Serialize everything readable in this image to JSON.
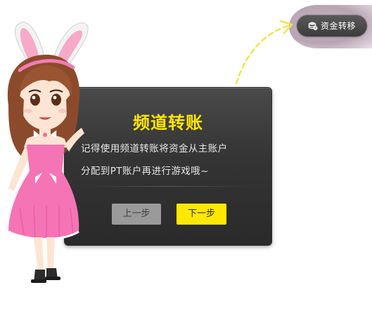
{
  "top_button": {
    "label": "资金转移",
    "icon": "coin-stack-icon"
  },
  "dialog": {
    "title": "频道转账",
    "line1": "记得使用频道转账将资金从主账户",
    "line2": "分配到PT账户再进行游戏哦~",
    "prev_label": "上一步",
    "next_label": "下一步"
  },
  "colors": {
    "title": "#ffe600",
    "next_button": "#ffe800",
    "prev_button": "#9a9a9a",
    "dialog_bg": "#333333",
    "arrow": "#f2e24a"
  },
  "character": {
    "description_icon": "bunny-girl-mascot"
  }
}
